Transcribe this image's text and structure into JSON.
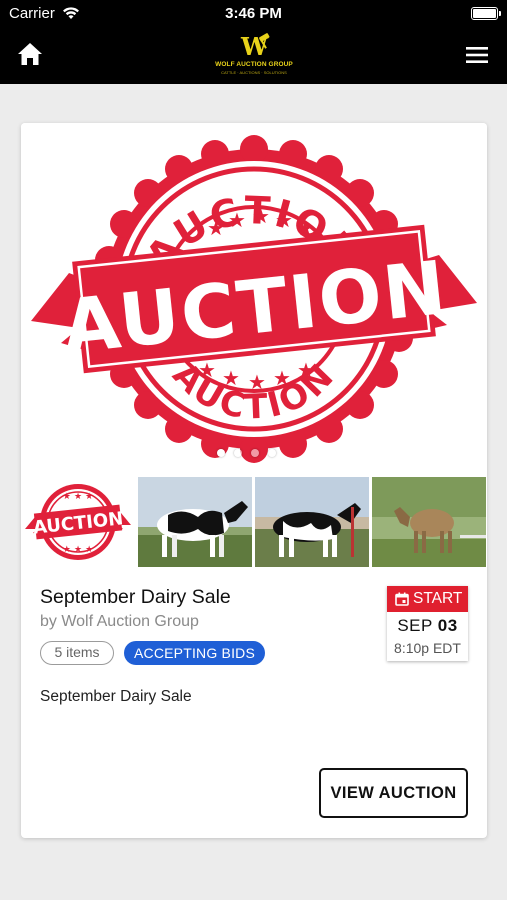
{
  "status_bar": {
    "carrier": "Carrier",
    "time": "3:46 PM"
  },
  "nav": {
    "logo_text": "WOLF AUCTION GROUP",
    "logo_tagline": "CATTLE · AUCTIONS · SOLUTIONS",
    "logo_mark": "W"
  },
  "hero": {
    "stamp_words": {
      "top": "AUCTION",
      "center": "AUCTION",
      "bottom": "AUCTION"
    },
    "stamp_color": "#e0213a",
    "slide_count": 4,
    "active_slide": 0
  },
  "thumbnails": [
    {
      "label": "AUCTION",
      "kind": "auction-stamp"
    },
    {
      "kind": "holstein-cow"
    },
    {
      "kind": "holstein-cow-show"
    },
    {
      "kind": "jersey-cow"
    }
  ],
  "listing": {
    "title": "September Dairy Sale",
    "byline": "by Wolf Auction Group",
    "items_badge": "5 items",
    "status_badge": "ACCEPTING BIDS",
    "description": "September Dairy Sale",
    "start": {
      "label": "START",
      "month": "SEP",
      "day": "03",
      "time": "8:10p EDT"
    },
    "view_button": "VIEW AUCTION"
  },
  "colors": {
    "status_blue": "#1f5fd6",
    "start_red": "#e0202f",
    "logo_gold": "#e8d21a"
  }
}
